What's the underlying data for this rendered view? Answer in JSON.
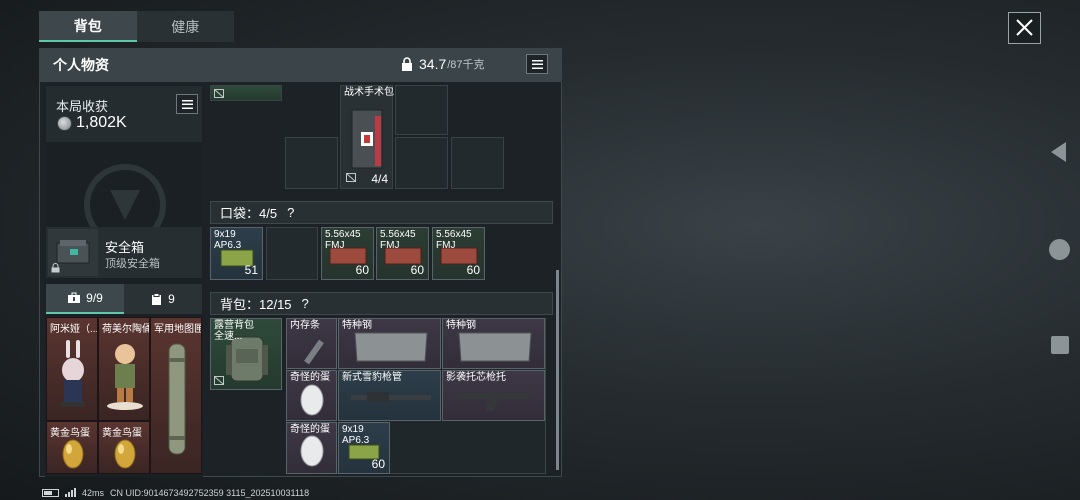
{
  "tabs": {
    "backpack": "背包",
    "health": "健康"
  },
  "panel": {
    "title": "个人物资",
    "weight_current": "34.7",
    "weight_max": "/87千克"
  },
  "income": {
    "label": "本局收获",
    "value": "1,802K"
  },
  "safebox": {
    "name": "安全箱",
    "type": "顶级安全箱"
  },
  "subtabs": {
    "equipment_count": "9/9",
    "other_count": "9"
  },
  "left_items": [
    {
      "name": "阿米娅（..."
    },
    {
      "name": "荷美尔陶俑"
    },
    {
      "name": "军用地图匣"
    },
    {
      "name": "黄金鸟蛋"
    },
    {
      "name": "黄金鸟蛋"
    }
  ],
  "top_grid": {
    "item_name": "战术手术包",
    "item_count": "4/4"
  },
  "pocket": {
    "label": "口袋：4/5",
    "help": "?",
    "items": [
      {
        "name": "9x19\nAP6.3",
        "count": "51"
      },
      {
        "name": "5.56x45\nFMJ",
        "count": "60"
      },
      {
        "name": "5.56x45\nFMJ",
        "count": "60"
      },
      {
        "name": "5.56x45\nFMJ",
        "count": "60"
      }
    ]
  },
  "backpack": {
    "label": "背包：12/15",
    "help": "?",
    "bag_name": "露营背包\n全速...",
    "items": [
      {
        "name": "内存条"
      },
      {
        "name": "特种钢"
      },
      {
        "name": "特种钢"
      },
      {
        "name": "奇怪的蛋"
      },
      {
        "name": "新式雪豹枪管"
      },
      {
        "name": "影袭托芯枪托"
      },
      {
        "name": "奇怪的蛋"
      },
      {
        "name": "9x19\nAP6.3",
        "count": "60"
      }
    ]
  },
  "status": {
    "ping": "42ms",
    "uid": "CN UID:9014673492752359 3115_202510031118"
  }
}
